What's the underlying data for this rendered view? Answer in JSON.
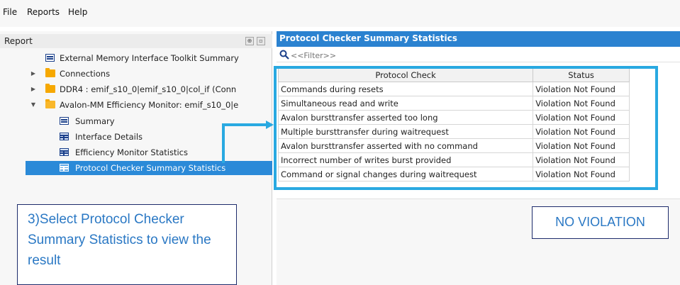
{
  "menu": {
    "file": "File",
    "reports": "Reports",
    "help": "Help"
  },
  "report_pane": {
    "title": "Report",
    "header_buttons": [
      "pin-icon",
      "restore-icon"
    ]
  },
  "tree": {
    "items": [
      {
        "label": "External Memory Interface Toolkit Summary",
        "icon": "report-icon",
        "expander": "none"
      },
      {
        "label": "Connections",
        "icon": "folder-icon",
        "expander": "collapsed"
      },
      {
        "label": "DDR4 : emif_s10_0|emif_s10_0|col_if (Conn",
        "icon": "folder-icon",
        "expander": "collapsed"
      },
      {
        "label": "Avalon-MM Efficiency Monitor: emif_s10_0|e",
        "icon": "open-folder-icon",
        "expander": "expanded"
      },
      {
        "label": "Summary",
        "icon": "report-icon",
        "expander": "none"
      },
      {
        "label": "Interface Details",
        "icon": "table-icon",
        "expander": "none"
      },
      {
        "label": "Efficiency Monitor Statistics",
        "icon": "table-icon",
        "expander": "none"
      },
      {
        "label": "Protocol Checker Summary Statistics",
        "icon": "table-icon",
        "expander": "none",
        "selected": true
      }
    ]
  },
  "panel": {
    "title": "Protocol Checker Summary Statistics",
    "filter_placeholder": "<<Filter>>",
    "columns": [
      "Protocol Check",
      "Status"
    ],
    "rows": [
      [
        "Commands during resets",
        "Violation Not Found"
      ],
      [
        "Simultaneous read and write",
        "Violation Not Found"
      ],
      [
        "Avalon bursttransfer asserted too long",
        "Violation Not Found"
      ],
      [
        "Multiple bursttransfer during waitrequest",
        "Violation Not Found"
      ],
      [
        "Avalon bursttransfer asserted with no command",
        "Violation Not Found"
      ],
      [
        "Incorrect number of writes burst provided",
        "Violation Not Found"
      ],
      [
        "Command or signal changes during waitrequest",
        "Violation Not Found"
      ]
    ]
  },
  "annotations": {
    "callout": "3)Select Protocol Checker Summary Statistics to view the result",
    "result": "NO VIOLATION"
  },
  "colors": {
    "accent": "#29a9e1",
    "selection": "#2b8ad8",
    "title_bar": "#2b82d0",
    "annotation_text": "#2a78c4",
    "annotation_border": "#1d2b6b"
  }
}
